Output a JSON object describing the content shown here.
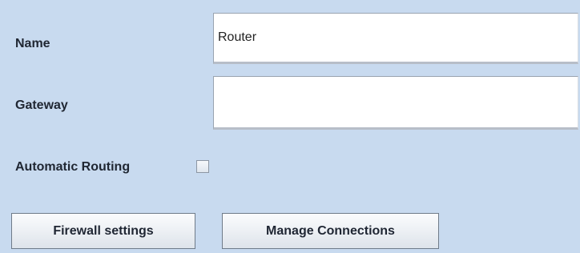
{
  "form": {
    "name_label": "Name",
    "name_value": "Router",
    "gateway_label": "Gateway",
    "gateway_value": "",
    "automatic_routing_label": "Automatic Routing",
    "automatic_routing_checked": false
  },
  "buttons": {
    "firewall_label": "Firewall settings",
    "manage_label": "Manage Connections"
  },
  "colors": {
    "panel_background": "#c8daef",
    "field_background": "#ffffff",
    "button_border": "#6f7b89"
  }
}
